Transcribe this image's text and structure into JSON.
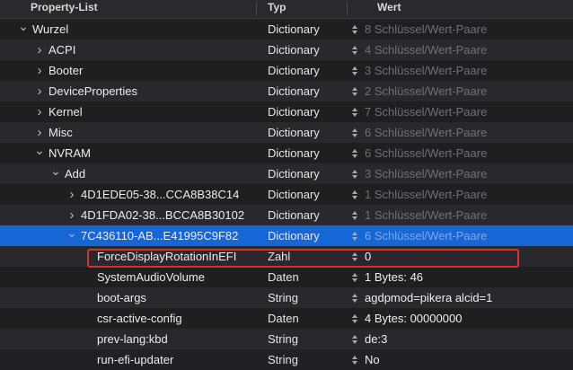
{
  "header": {
    "property_list": "Property-List",
    "type": "Typ",
    "value": "Wert"
  },
  "rows": [
    {
      "name": "Wurzel",
      "type": "Dictionary",
      "value": "8 Schlüssel/Wert-Paare",
      "disclosure": "expanded",
      "depth": 0
    },
    {
      "name": "ACPI",
      "type": "Dictionary",
      "value": "4 Schlüssel/Wert-Paare",
      "disclosure": "collapsed",
      "depth": 1
    },
    {
      "name": "Booter",
      "type": "Dictionary",
      "value": "3 Schlüssel/Wert-Paare",
      "disclosure": "collapsed",
      "depth": 1
    },
    {
      "name": "DeviceProperties",
      "type": "Dictionary",
      "value": "2 Schlüssel/Wert-Paare",
      "disclosure": "collapsed",
      "depth": 1
    },
    {
      "name": "Kernel",
      "type": "Dictionary",
      "value": "7 Schlüssel/Wert-Paare",
      "disclosure": "collapsed",
      "depth": 1
    },
    {
      "name": "Misc",
      "type": "Dictionary",
      "value": "6 Schlüssel/Wert-Paare",
      "disclosure": "collapsed",
      "depth": 1
    },
    {
      "name": "NVRAM",
      "type": "Dictionary",
      "value": "6 Schlüssel/Wert-Paare",
      "disclosure": "expanded",
      "depth": 1
    },
    {
      "name": "Add",
      "type": "Dictionary",
      "value": "3 Schlüssel/Wert-Paare",
      "disclosure": "expanded",
      "depth": 2
    },
    {
      "name": "4D1EDE05-38...CCA8B38C14",
      "type": "Dictionary",
      "value": "1 Schlüssel/Wert-Paare",
      "disclosure": "collapsed",
      "depth": 3
    },
    {
      "name": "4D1FDA02-38...BCCA8B30102",
      "type": "Dictionary",
      "value": "1 Schlüssel/Wert-Paare",
      "disclosure": "collapsed",
      "depth": 3
    },
    {
      "name": "7C436110-AB...E41995C9F82",
      "type": "Dictionary",
      "value": "6 Schlüssel/Wert-Paare",
      "disclosure": "expanded",
      "depth": 3,
      "selected": true
    },
    {
      "name": "ForceDisplayRotationInEFI",
      "type": "Zahl",
      "value": "0",
      "depth": 4
    },
    {
      "name": "SystemAudioVolume",
      "type": "Daten",
      "value": "1 Bytes: 46",
      "depth": 4
    },
    {
      "name": "boot-args",
      "type": "String",
      "value": "agdpmod=pikera alcid=1",
      "depth": 4,
      "highlighted": true
    },
    {
      "name": "csr-active-config",
      "type": "Daten",
      "value": "4 Bytes: 00000000",
      "depth": 4
    },
    {
      "name": "prev-lang:kbd",
      "type": "String",
      "value": "de:3",
      "depth": 4
    },
    {
      "name": "run-efi-updater",
      "type": "String",
      "value": "No",
      "depth": 4
    }
  ],
  "colors": {
    "selection": "#1766d6",
    "highlight_border": "#d3362e",
    "background": "#1f1f22"
  },
  "icons": {
    "expanded": "chevron-down-icon",
    "collapsed": "chevron-right-icon",
    "stepper": "stepper-icon"
  }
}
